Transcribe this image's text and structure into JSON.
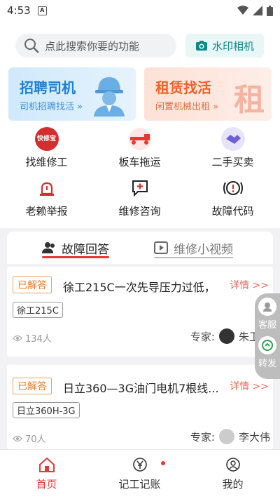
{
  "statusbar": {
    "time": "4:53"
  },
  "search": {
    "placeholder": "点此搜索你要的功能"
  },
  "watermark": {
    "label": "水印相机"
  },
  "banners": [
    {
      "title": "招聘司机",
      "subtitle": "司机招聘找活 »"
    },
    {
      "title": "租赁找活",
      "subtitle": "闲置机械出租 »",
      "big_char": "租"
    }
  ],
  "grid": [
    {
      "label": "找维修工",
      "icon": "kuaixiubao-icon",
      "badge": "快修宝"
    },
    {
      "label": "板车拖运",
      "icon": "truck-icon"
    },
    {
      "label": "二手买卖",
      "icon": "handshake-icon"
    },
    {
      "label": "老赖举报",
      "icon": "alarm-icon"
    },
    {
      "label": "维修咨询",
      "icon": "chat-plus-icon"
    },
    {
      "label": "故障代码",
      "icon": "warning-code-icon"
    }
  ],
  "tabs": [
    {
      "label": "故障回答",
      "active": true
    },
    {
      "label": "维修小视频",
      "active": false
    }
  ],
  "cards": [
    {
      "status": "已解答",
      "title": "徐工215C一次先导压力过低，",
      "more": "详情 >>",
      "tag": "徐工215C",
      "views": "134人",
      "expert_label": "专家:",
      "expert_name": "朱卫东"
    },
    {
      "status": "已解答",
      "title": "日立360—3G油门电机7根线...",
      "more": "详情 >>",
      "tag": "日立360H-3G",
      "views": "70人",
      "expert_label": "专家:",
      "expert_name": "李大伟"
    }
  ],
  "float": [
    {
      "label": "客服"
    },
    {
      "label": "转发"
    }
  ],
  "nav": [
    {
      "label": "首页",
      "active": true
    },
    {
      "label": "记工记账",
      "active": false
    },
    {
      "label": "我的",
      "active": false
    }
  ],
  "colors": {
    "accent": "#e63838",
    "teal": "#0b8a8a",
    "orange": "#ef7d2c"
  }
}
